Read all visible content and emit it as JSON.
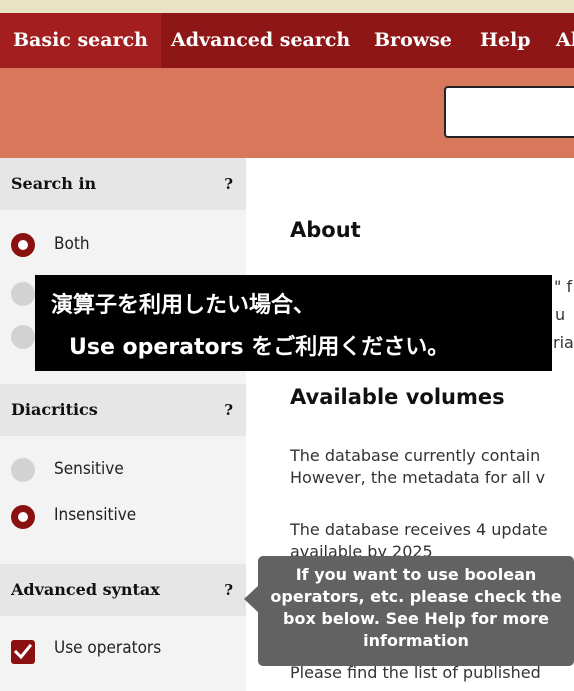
{
  "nav": {
    "items": [
      {
        "label": "Basic search",
        "active": true
      },
      {
        "label": "Advanced search",
        "active": false
      },
      {
        "label": "Browse",
        "active": false
      },
      {
        "label": "Help",
        "active": false
      },
      {
        "label": "Al",
        "active": false
      }
    ]
  },
  "search": {
    "value": ""
  },
  "sidebar": {
    "search_in": {
      "title": "Search in",
      "help": "?",
      "options": [
        {
          "label": "Both",
          "selected": true
        }
      ]
    },
    "diacritics": {
      "title": "Diacritics",
      "help": "?",
      "options": [
        {
          "label": "Sensitive",
          "selected": false
        },
        {
          "label": "Insensitive",
          "selected": true
        }
      ]
    },
    "advanced_syntax": {
      "title": "Advanced syntax",
      "help": "?",
      "checkbox_label": "Use operators",
      "checked": true
    }
  },
  "main": {
    "about_title": "About",
    "about_fragments": [
      "\" f",
      "u",
      "ria"
    ],
    "volumes_title": "Available volumes",
    "para1": [
      "The database currently contain",
      "However, the metadata for all v"
    ],
    "para2": [
      "The database receives 4 update",
      "available by 2025"
    ],
    "para3_fragment": "Please find the list of published"
  },
  "overlay": {
    "line1": "演算子を利用したい場合、",
    "line2": "Use operators をご利用ください。"
  },
  "tooltip": {
    "text": "If you want to use boolean operators, etc. please check the box below. See Help for more information"
  },
  "colors": {
    "nav_bg": "#8e1616",
    "search_bar_bg": "#d9775c",
    "accent": "#8b1010",
    "tooltip_bg": "#626262"
  }
}
